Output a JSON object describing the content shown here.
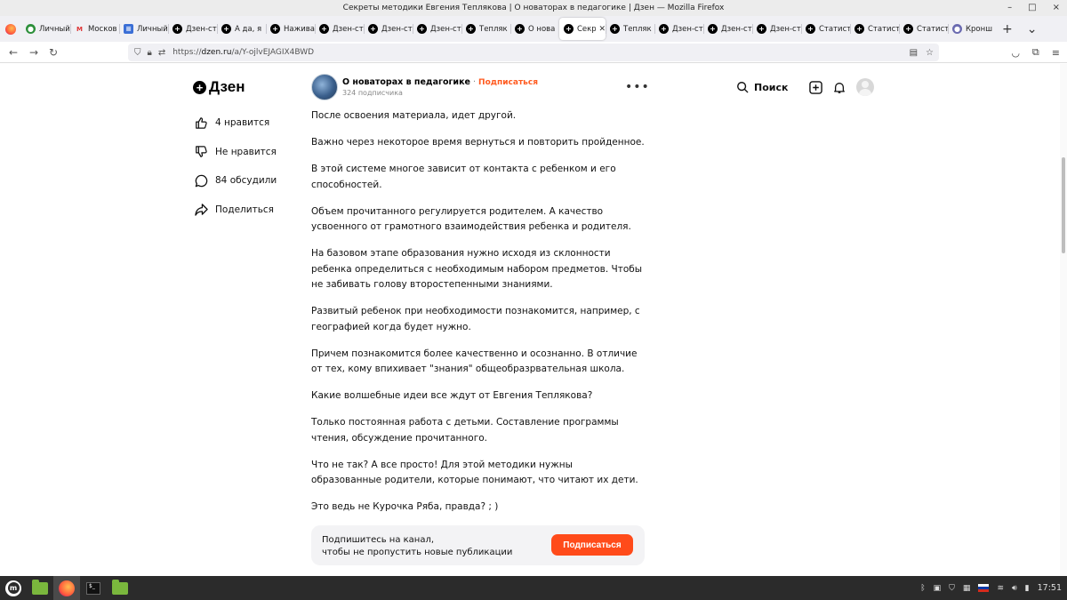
{
  "window": {
    "title": "Секреты методики Евгения Теплякова | О новаторах в педагогике | Дзен — Mozilla Firefox",
    "controls": [
      "–",
      "□",
      "×"
    ]
  },
  "tabs": [
    {
      "label": "Личный",
      "icon": "ok-icon"
    },
    {
      "label": "Москов",
      "icon": "mos-icon"
    },
    {
      "label": "Личный",
      "icon": "doc-icon"
    },
    {
      "label": "Дзен-ст",
      "icon": "dzen-icon"
    },
    {
      "label": "А да, я",
      "icon": "dzen-icon"
    },
    {
      "label": "Нажива",
      "icon": "dzen-icon"
    },
    {
      "label": "Дзен-ст",
      "icon": "dzen-icon"
    },
    {
      "label": "Дзен-ст",
      "icon": "dzen-icon"
    },
    {
      "label": "Дзен-ст",
      "icon": "dzen-icon"
    },
    {
      "label": "Тепляк",
      "icon": "dzen-icon"
    },
    {
      "label": "О нова",
      "icon": "dzen-icon"
    },
    {
      "label": "Секр",
      "icon": "dzen-icon",
      "active": true
    },
    {
      "label": "Тепляк",
      "icon": "dzen-icon"
    },
    {
      "label": "Дзен-ст",
      "icon": "dzen-icon"
    },
    {
      "label": "Дзен-ст",
      "icon": "dzen-icon"
    },
    {
      "label": "Дзен-ст",
      "icon": "dzen-icon"
    },
    {
      "label": "Статист",
      "icon": "dzen-icon"
    },
    {
      "label": "Статист",
      "icon": "dzen-icon"
    },
    {
      "label": "Статист",
      "icon": "dzen-icon"
    },
    {
      "label": "Кронш",
      "icon": "user-icon"
    }
  ],
  "navbar": {
    "url_prefix": "https://",
    "url_host": "dzen.ru",
    "url_path": "/a/Y-ojlvEJAGIX4BWD"
  },
  "brand": {
    "logo_text": "Дзен",
    "accent_color": "#ff4b1a"
  },
  "channel": {
    "name": "О новаторах в педагогике",
    "separator": " · ",
    "subscribe_link": "Подписаться",
    "subscribers": "324 подписчика"
  },
  "header": {
    "search_label": "Поиск"
  },
  "actions": [
    {
      "label": "4 нравится",
      "icon": "thumb-up-icon"
    },
    {
      "label": "Не нравится",
      "icon": "thumb-down-icon"
    },
    {
      "label": "84 обсудили",
      "icon": "comment-icon"
    },
    {
      "label": "Поделиться",
      "icon": "share-icon"
    }
  ],
  "article": {
    "paragraphs": [
      "После освоения материала, идет другой.",
      "Важно через некоторое время вернуться и повторить пройденное.",
      "В этой системе многое зависит от контакта с ребенком и его способностей.",
      "Объем прочитанного регулируется родителем. А качество усвоенного от грамотного взаимодействия ребенка и родителя.",
      "На базовом этапе образования нужно исходя из склонности ребенка определиться с необходимым набором предметов. Чтобы не забивать голову второстепенными знаниями.",
      "Развитый ребенок при необходимости познакомится, например, с географией когда будет нужно.",
      "Причем познакомится более качественно и осознанно. В отличие от тех, кому впихивает \"знания\" общеобразрвательная школа.",
      "Какие волшебные идеи все ждут от Евгения Теплякова?",
      "Только постоянная работа с детьми. Составление программы чтения, обсуждение прочитанного.",
      "Что не так? А все просто! Для этой методики нужны образованные родители, которые понимают, что читают их дети.",
      "Это ведь не Курочка Ряба, правда? ; )"
    ]
  },
  "subscribe_card": {
    "line1": "Подпишитесь на канал,",
    "line2": "чтобы не пропустить новые публикации",
    "button": "Подписаться"
  },
  "taskbar": {
    "clock": "17:51"
  }
}
